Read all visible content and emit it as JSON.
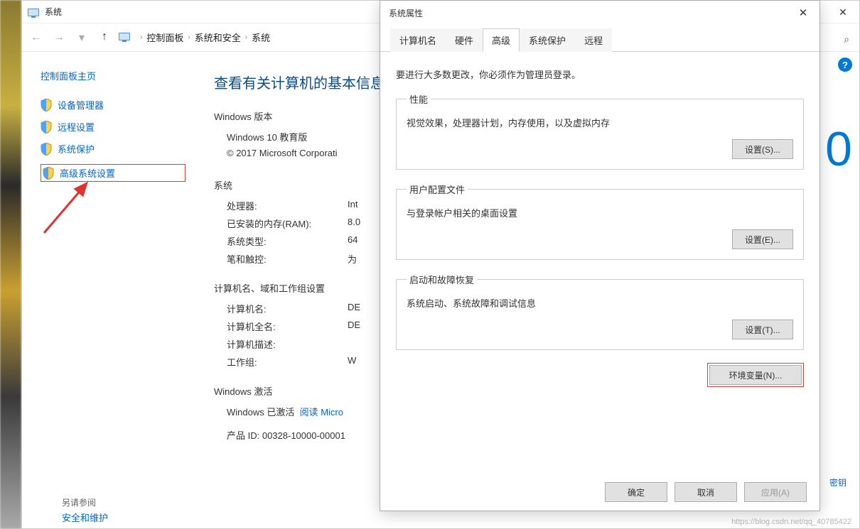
{
  "bgWindow": {
    "title": "系统",
    "breadcrumb": {
      "root": "控制面板",
      "mid": "系统和安全",
      "leaf": "系统"
    },
    "sidebar": {
      "home": "控制面板主页",
      "links": [
        "设备管理器",
        "远程设置",
        "系统保护",
        "高级系统设置"
      ],
      "seeAlsoLabel": "另请参阅",
      "seeAlso": "安全和维护"
    },
    "content": {
      "heading": "查看有关计算机的基本信息",
      "winver_h": "Windows 版本",
      "winver": "Windows 10 教育版",
      "copyright": "© 2017 Microsoft Corporati",
      "sys_h": "系统",
      "rows": {
        "cpu_k": "处理器:",
        "cpu_v": "Int",
        "ram_k": "已安装的内存(RAM):",
        "ram_v": "8.0",
        "type_k": "系统类型:",
        "type_v": "64",
        "pen_k": "笔和触控:",
        "pen_v": "为"
      },
      "name_h": "计算机名、域和工作组设置",
      "name_rows": {
        "cn_k": "计算机名:",
        "cn_v": "DE",
        "cfn_k": "计算机全名:",
        "cfn_v": "DE",
        "cd_k": "计算机描述:",
        "cd_v": "",
        "wg_k": "工作组:",
        "wg_v": "W"
      },
      "act_h": "Windows 激活",
      "act_line": "Windows 已激活",
      "act_link": "阅读 Micro",
      "pid": "产品 ID: 00328-10000-00001",
      "logo": "0",
      "right_text": "密钥"
    }
  },
  "dialog": {
    "title": "系统属性",
    "tabs": [
      "计算机名",
      "硬件",
      "高级",
      "系统保护",
      "远程"
    ],
    "activeTab": 2,
    "intro": "要进行大多数更改，你必须作为管理员登录。",
    "perf_legend": "性能",
    "perf_desc": "视觉效果，处理器计划，内存使用，以及虚拟内存",
    "perf_btn": "设置(S)...",
    "prof_legend": "用户配置文件",
    "prof_desc": "与登录帐户相关的桌面设置",
    "prof_btn": "设置(E)...",
    "boot_legend": "启动和故障恢复",
    "boot_desc": "系统启动、系统故障和调试信息",
    "boot_btn": "设置(T)...",
    "env_btn": "环境变量(N)...",
    "ok": "确定",
    "cancel": "取消",
    "apply": "应用(A)"
  },
  "watermark": "https://blog.csdn.net/qq_40785422"
}
